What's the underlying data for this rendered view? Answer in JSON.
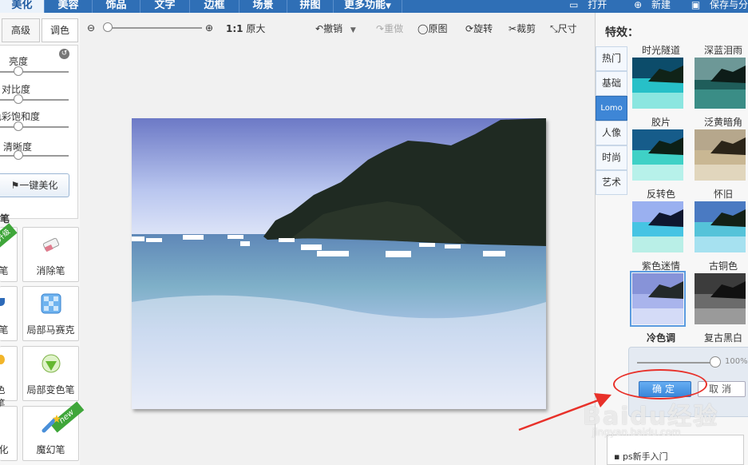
{
  "nav": {
    "tabs": [
      "美化",
      "美容",
      "饰品",
      "文字",
      "边框",
      "场景",
      "拼图",
      "更多功能"
    ],
    "actions": [
      "打开",
      "新建",
      "保存与分"
    ]
  },
  "left": {
    "subtabs": [
      "高级",
      "调色"
    ],
    "sliders": [
      "亮度",
      "对比度",
      "色彩饱和度",
      "清晰度"
    ],
    "one_click": "一键美化",
    "section": "画笔",
    "tools": [
      "笔",
      "消除笔",
      "笔",
      "局部马赛克",
      "色笔",
      "局部变色笔",
      "化",
      "魔幻笔"
    ],
    "badges": [
      "升级",
      "new"
    ]
  },
  "toolbar": {
    "ratio": "1:1",
    "original_size": "原大",
    "undo": "撤销",
    "redo": "重做",
    "original": "原图",
    "rotate": "旋转",
    "crop": "裁剪",
    "size": "尺寸"
  },
  "right": {
    "title": "特效：",
    "categories": [
      "热门",
      "基础",
      "Lomo",
      "人像",
      "时尚",
      "艺术"
    ],
    "effects": [
      "时光隧道",
      "深蓝泪雨",
      "胶片",
      "泛黄暗角",
      "反转色",
      "怀旧",
      "紫色迷情",
      "古铜色"
    ],
    "below_labels": [
      "冷色调",
      "复古黑白"
    ],
    "intensity": "100%",
    "ok": "确定",
    "cancel": "取消",
    "help_item": "ps新手入门"
  },
  "watermark": {
    "brand": "Baidu经验",
    "url": "jingyan.baidu.com"
  },
  "colors": {
    "nav": "#2f6fb6",
    "accent": "#3e86d6",
    "annotation": "#e8312a"
  }
}
